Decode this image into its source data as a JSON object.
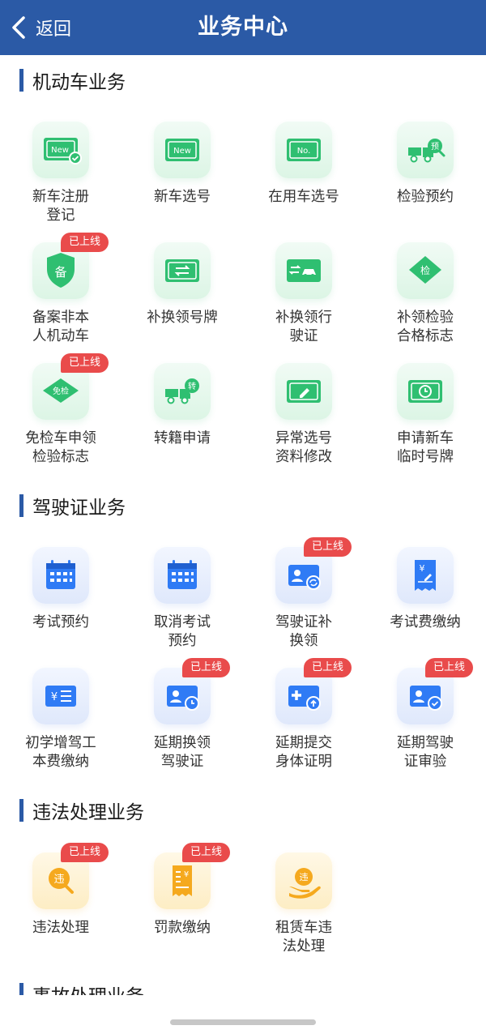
{
  "header": {
    "back_label": "返回",
    "title": "业务中心",
    "color": "#2b5aa6"
  },
  "badge_label": "已上线",
  "sections": [
    {
      "title": "机动车业务",
      "items": [
        {
          "label": "新车注册\n登记",
          "icon": "new-plate-check-icon",
          "badge": false
        },
        {
          "label": "新车选号",
          "icon": "new-plate-icon",
          "badge": false
        },
        {
          "label": "在用车选号",
          "icon": "number-plate-icon",
          "badge": false
        },
        {
          "label": "检验预约",
          "icon": "truck-search-icon",
          "badge": false
        },
        {
          "label": "备案非本\n人机动车",
          "icon": "shield-record-icon",
          "badge": true
        },
        {
          "label": "补换领号牌",
          "icon": "plate-swap-icon",
          "badge": false
        },
        {
          "label": "补换领行\n驶证",
          "icon": "license-swap-icon",
          "badge": false
        },
        {
          "label": "补领检验\n合格标志",
          "icon": "inspection-mark-icon",
          "badge": false
        },
        {
          "label": "免检车申领\n检验标志",
          "icon": "exempt-mark-icon",
          "badge": true
        },
        {
          "label": "转籍申请",
          "icon": "truck-transfer-icon",
          "badge": false
        },
        {
          "label": "异常选号\n资料修改",
          "icon": "plate-edit-icon",
          "badge": false
        },
        {
          "label": "申请新车\n临时号牌",
          "icon": "temp-plate-icon",
          "badge": false
        }
      ]
    },
    {
      "title": "驾驶证业务",
      "items": [
        {
          "label": "考试预约",
          "icon": "calendar-icon",
          "badge": false
        },
        {
          "label": "取消考试\n预约",
          "icon": "calendar-cancel-icon",
          "badge": false
        },
        {
          "label": "驾驶证补\n换领",
          "icon": "id-card-refresh-icon",
          "badge": true
        },
        {
          "label": "考试费缴纳",
          "icon": "yen-receipt-icon",
          "badge": false
        },
        {
          "label": "初学增驾工\n本费缴纳",
          "icon": "yen-list-icon",
          "badge": false
        },
        {
          "label": "延期换领\n驾驶证",
          "icon": "id-card-clock-icon",
          "badge": true
        },
        {
          "label": "延期提交\n身体证明",
          "icon": "medical-upload-icon",
          "badge": true
        },
        {
          "label": "延期驾驶\n证审验",
          "icon": "id-card-check-icon",
          "badge": true
        }
      ]
    },
    {
      "title": "违法处理业务",
      "items": [
        {
          "label": "违法处理",
          "icon": "violation-search-icon",
          "badge": true
        },
        {
          "label": "罚款缴纳",
          "icon": "fine-receipt-icon",
          "badge": true
        },
        {
          "label": "租赁车违\n法处理",
          "icon": "rental-violation-icon",
          "badge": false
        }
      ]
    },
    {
      "title": "事故处理业务",
      "items": []
    }
  ]
}
